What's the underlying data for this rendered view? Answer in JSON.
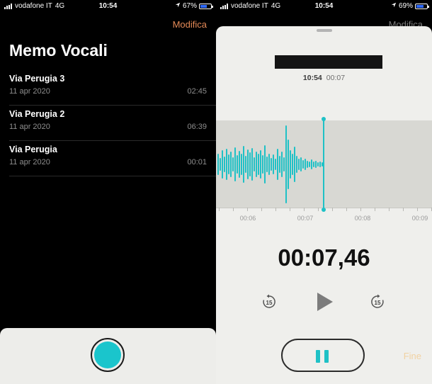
{
  "left_screen": {
    "status": {
      "carrier": "vodafone IT",
      "network": "4G",
      "time": "10:54",
      "battery": "67%",
      "battery_level": 0.67
    },
    "edit_label": "Modifica",
    "title": "Memo Vocali",
    "recordings": [
      {
        "name": "Via Perugia 3",
        "date": "11 apr 2020",
        "duration": "02:45"
      },
      {
        "name": "Via Perugia 2",
        "date": "11 apr 2020",
        "duration": "06:39"
      },
      {
        "name": "Via Perugia",
        "date": "11 apr 2020",
        "duration": "00:01"
      }
    ],
    "colors": {
      "accent": "#e58a57",
      "record": "#1ac5cc"
    }
  },
  "right_screen": {
    "status": {
      "carrier": "vodafone IT",
      "network": "4G",
      "time": "10:54",
      "battery": "69%",
      "battery_level": 0.69
    },
    "ghost_edit_label": "Modifica",
    "recording_time": "10:54",
    "recording_duration": "00:07",
    "timeline_labels": [
      "00:06",
      "00:07",
      "00:08",
      "00:09"
    ],
    "timer": "00:07,46",
    "skip_back_label": "15",
    "skip_forward_label": "15",
    "done_label": "Fine",
    "colors": {
      "waveform": "#1fc1c6",
      "done": "#f1d2a2"
    }
  }
}
